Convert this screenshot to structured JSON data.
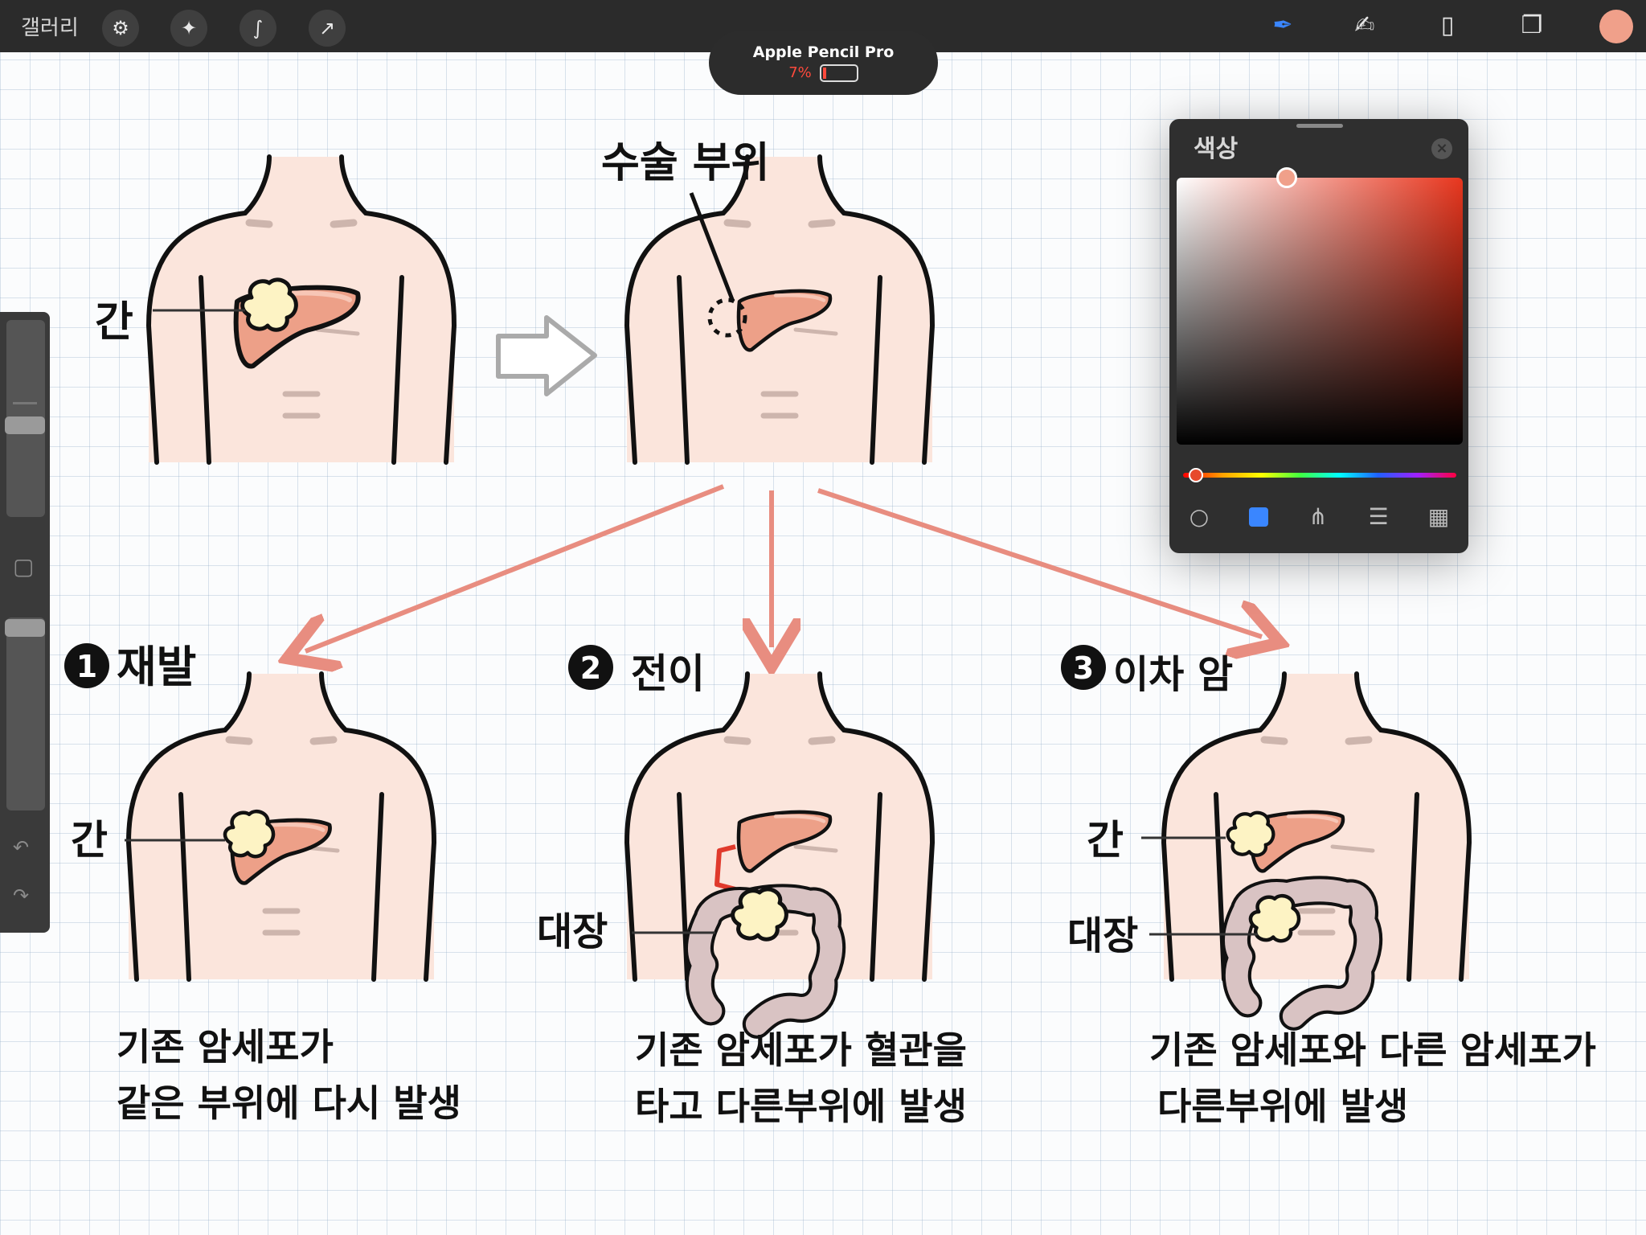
{
  "topbar": {
    "gallery_label": "갤러리",
    "left_tools": [
      "wrench-icon",
      "magic-wand-icon",
      "selection-icon",
      "move-arrow-icon"
    ],
    "right_tools": [
      "brush-icon",
      "smudge-icon",
      "eraser-icon",
      "layers-icon"
    ],
    "active_tool": "brush-icon",
    "current_color": "#f0a08a"
  },
  "pencil_popup": {
    "device": "Apple Pencil Pro",
    "battery": "7%"
  },
  "sidebar": {
    "brush_size_level": 0.35,
    "opacity_level": 0.03,
    "modify_button": "modify-square-icon",
    "undo_icon": "undo-icon",
    "redo_icon": "redo-icon"
  },
  "color_panel": {
    "title": "색상",
    "selected_color": "#f0a08a",
    "hue_color": "#e8361e",
    "tabs": [
      "disc-icon",
      "classic-square-icon",
      "harmony-icon",
      "value-sliders-icon",
      "palette-grid-icon"
    ],
    "active_tab": "classic-square-icon"
  },
  "drawing": {
    "label_liver": "간",
    "label_surgery": "수술 부위",
    "label_colon": "대장",
    "case1_num": "1",
    "case1_title": "재발",
    "case2_num": "2",
    "case2_title": "전이",
    "case3_num": "3",
    "case3_title": "이차 암",
    "case1_desc_line1": "기존 암세포가",
    "case1_desc_line2": "같은 부위에 다시 발생",
    "case2_desc_line1": "기존 암세포가 혈관을",
    "case2_desc_line2": "타고 다른부위에 발생",
    "case3_desc_line1": "기존 암세포와 다른 암세포가",
    "case3_desc_line2": "다른부위에 발생",
    "skin_color": "#fbe5dc",
    "liver_color": "#eda088",
    "tumor_color": "#fdf3c4",
    "colon_color": "#d9c3c3",
    "arrow_color": "#e88d80",
    "vessel_color": "#e03a2c"
  }
}
